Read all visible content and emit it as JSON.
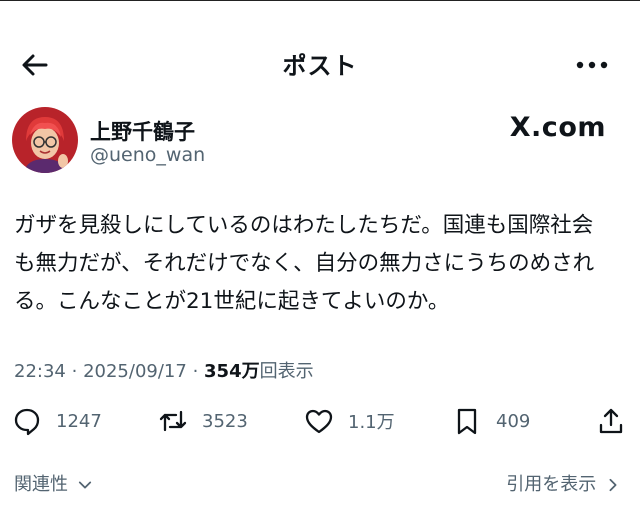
{
  "header": {
    "title": "ポスト"
  },
  "author": {
    "name": "上野千鶴子",
    "handle": "@ueno_wan"
  },
  "watermark": "X.com",
  "tweet": {
    "text": "ガザを見殺しにしているのはわたしたちだ。国連も国際社会も無力だが、それだけでなく、自分の無力さにうちのめされる。こんなことが21世紀に起きてよいのか。"
  },
  "meta": {
    "time": "22:34",
    "date": "2025/09/17",
    "sep": "·",
    "views": "354万",
    "views_label": "回表示"
  },
  "actions": {
    "replies": "1247",
    "reposts": "3523",
    "likes": "1.1万",
    "bookmarks": "409"
  },
  "footer": {
    "related": "関連性",
    "view_quotes": "引用を表示"
  },
  "colors": {
    "text": "#0f1419",
    "secondary": "#536471",
    "avatar_bg": "#b8232a"
  }
}
